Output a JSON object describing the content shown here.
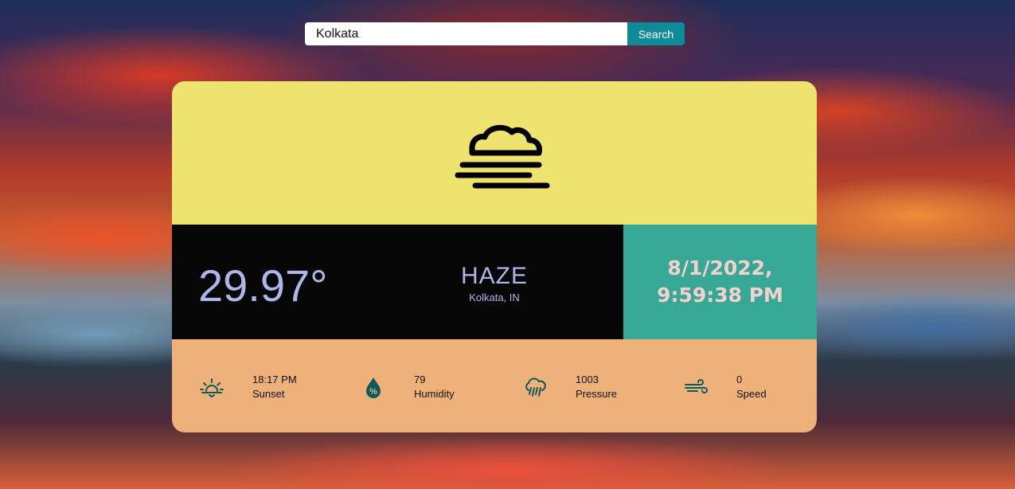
{
  "search": {
    "value": "Kolkata",
    "button_label": "Search"
  },
  "weather": {
    "icon": "haze-icon",
    "temperature": "29.97°",
    "condition": "HAZE",
    "location": "Kolkata, IN",
    "datetime": "8/1/2022, 9:59:38 PM"
  },
  "stats": [
    {
      "icon": "sunset-icon",
      "value": "18:17 PM",
      "label": "Sunset"
    },
    {
      "icon": "humidity-icon",
      "value": "79",
      "label": "Humidity"
    },
    {
      "icon": "pressure-icon",
      "value": "1003",
      "label": "Pressure"
    },
    {
      "icon": "wind-icon",
      "value": "0",
      "label": "Speed"
    }
  ],
  "colors": {
    "icon_panel": "#efe36f",
    "temp_panel": "#060606",
    "datetime_panel": "#37a895",
    "stats_panel": "#eeb179",
    "search_button": "#0e8a98",
    "text_light": "#aeb6e9",
    "icon_color": "#0c5a5e"
  }
}
